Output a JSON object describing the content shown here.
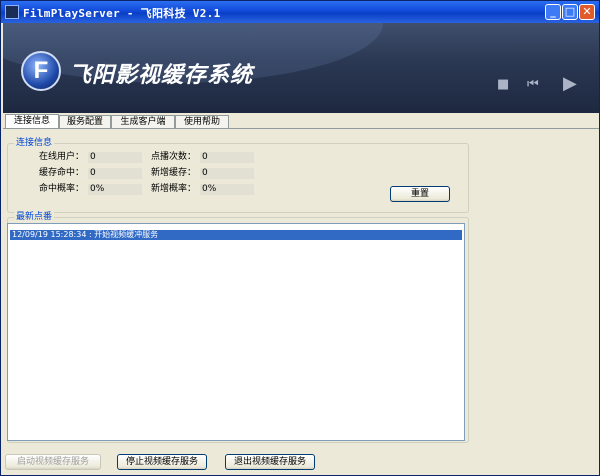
{
  "window": {
    "title": "FilmPlayServer - 飞阳科技 V2.1"
  },
  "banner": {
    "brand": "飞阳影视缓存系统",
    "logo_letter": "F"
  },
  "tabs": [
    {
      "label": "连接信息"
    },
    {
      "label": "服务配置"
    },
    {
      "label": "生成客户端"
    },
    {
      "label": "使用帮助"
    }
  ],
  "connection": {
    "title": "连接信息",
    "online_users_label": "在线用户：",
    "online_users": "0",
    "play_count_label": "点播次数：",
    "play_count": "0",
    "cache_hits_label": "缓存命中：",
    "cache_hits": "0",
    "new_cache_label": "新增缓存：",
    "new_cache": "0",
    "hit_rate_label": "命中概率：",
    "hit_rate": "0%",
    "new_rate_label": "新增概率：",
    "new_rate": "0%",
    "reset_label": "重置"
  },
  "latest": {
    "title": "最新点番",
    "log": [
      "12/09/19 15:28:34 : 开始视频缓冲服务"
    ]
  },
  "footer": {
    "start_label": "启动视频缓存服务",
    "stop_label": "停止视频缓存服务",
    "exit_label": "退出视频缓存服务"
  },
  "icons": [
    "app-icon",
    "minimize-icon",
    "maximize-icon",
    "close-icon",
    "stop-icon",
    "prev-icon",
    "play-icon"
  ]
}
